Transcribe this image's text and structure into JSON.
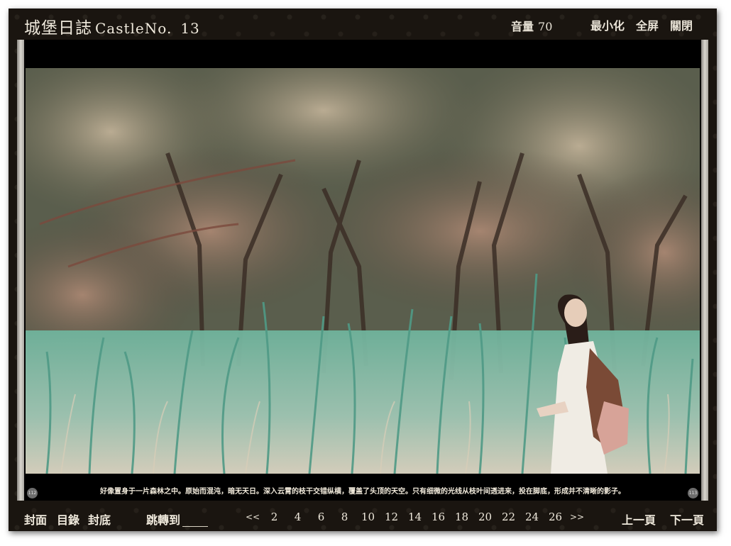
{
  "header": {
    "title": "城堡日誌",
    "subtitle": "CastleNo.",
    "issue_number": "13",
    "volume_label": "音量",
    "volume_value": "70",
    "minimize_label": "最小化",
    "fullscreen_label": "全屏",
    "close_label": "關閉"
  },
  "page": {
    "caption": "好像置身于一片森林之中。原始而混沌，暗无天日。深入云霄的枝干交错纵横，覆盖了头顶的天空。只有细微的光线从枝叶间透进来，投在脚底，形成并不清晰的影子。",
    "left_page_number": "112",
    "right_page_number": "113"
  },
  "footer": {
    "cover_label": "封面",
    "toc_label": "目錄",
    "back_cover_label": "封底",
    "jump_label": "跳轉到",
    "prev_arrow": "<<",
    "next_arrow": ">>",
    "page_links": [
      "2",
      "4",
      "6",
      "8",
      "10",
      "12",
      "14",
      "16",
      "18",
      "20",
      "22",
      "24",
      "26"
    ],
    "prev_page_label": "上一頁",
    "next_page_label": "下一頁"
  },
  "colors": {
    "frame_background": "#1a1510",
    "text": "#efe9dc",
    "page_background": "#000000"
  }
}
